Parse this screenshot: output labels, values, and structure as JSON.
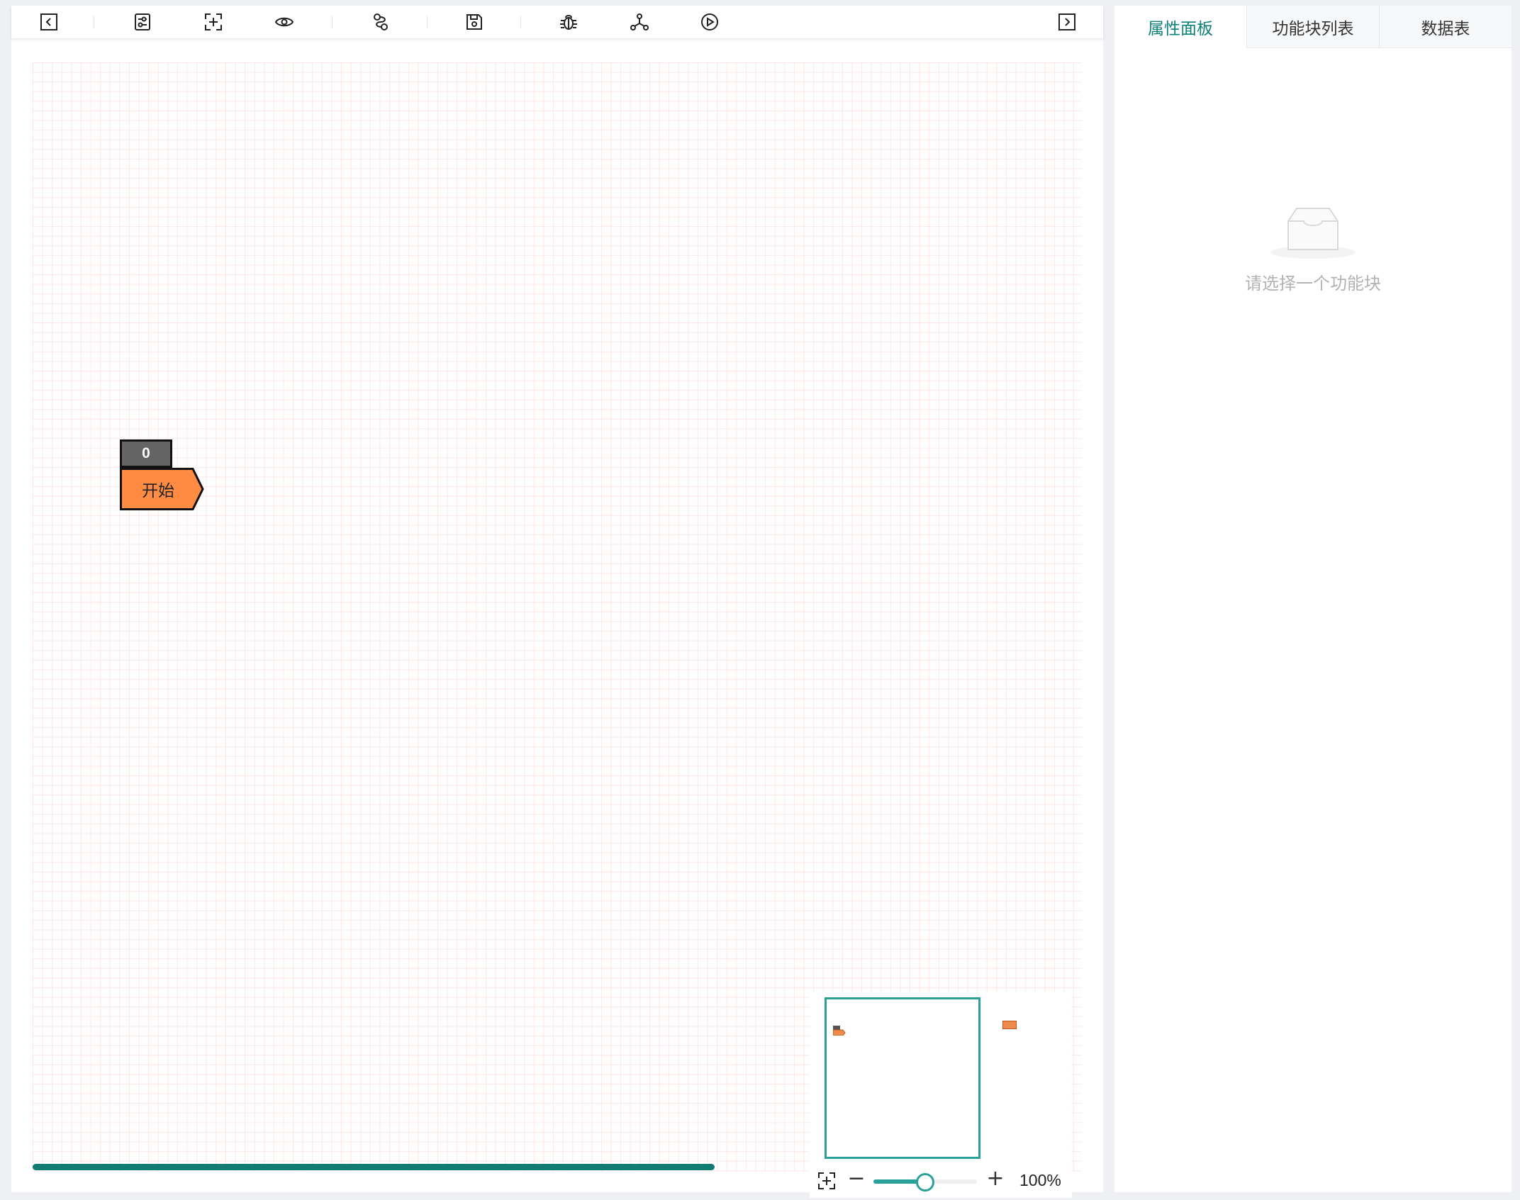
{
  "toolbar": {
    "buttons": [
      {
        "name": "collapse-left",
        "icon": "arrow-left-box-icon"
      },
      {
        "name": "settings",
        "icon": "sliders-icon"
      },
      {
        "name": "fit-view",
        "icon": "fit-screen-icon"
      },
      {
        "name": "preview",
        "icon": "eye-icon"
      },
      {
        "name": "link",
        "icon": "link-icon"
      },
      {
        "name": "save",
        "icon": "save-icon"
      },
      {
        "name": "debug",
        "icon": "bug-icon"
      },
      {
        "name": "network",
        "icon": "network-icon"
      },
      {
        "name": "run",
        "icon": "play-circle-icon"
      },
      {
        "name": "expand-right",
        "icon": "arrow-right-box-icon"
      }
    ]
  },
  "canvas": {
    "start_block": {
      "index": "0",
      "label": "开始",
      "color": "#ff8c42"
    }
  },
  "minimap": {
    "zoom_label": "100%",
    "zoom_fraction": 0.5,
    "zoom_minus": "−",
    "zoom_plus": "+"
  },
  "panel": {
    "tabs": [
      {
        "label": "属性面板",
        "active": true
      },
      {
        "label": "功能块列表",
        "active": false
      },
      {
        "label": "数据表",
        "active": false
      }
    ],
    "empty_text": "请选择一个功能块"
  },
  "colors": {
    "accent": "#0d7f77",
    "teal": "#2aa198",
    "block_orange": "#ff8c42"
  }
}
